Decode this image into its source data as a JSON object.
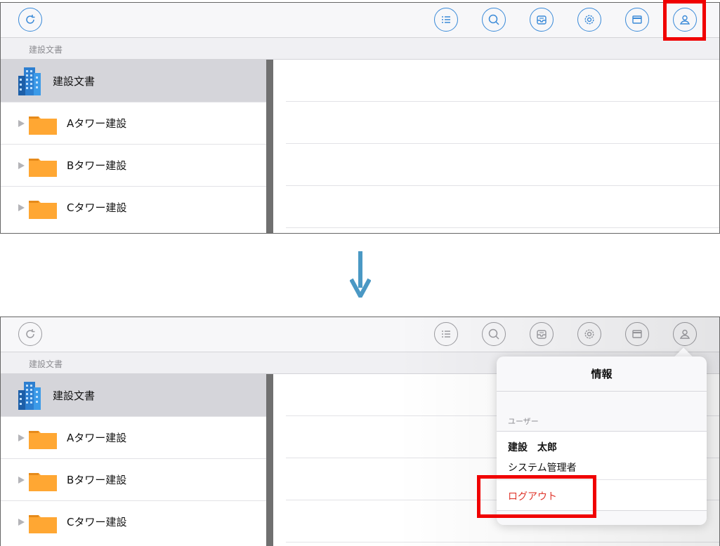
{
  "path": "建設文書",
  "tree": {
    "root": "建設文書",
    "items": [
      "Aタワー建設",
      "Bタワー建設",
      "Cタワー建設"
    ]
  },
  "toolbar_icons": [
    "refresh-icon",
    "list-icon",
    "search-icon",
    "inbox-icon",
    "gear-icon",
    "window-icon",
    "user-icon"
  ],
  "popover": {
    "title": "情報",
    "section_label": "ユーザー",
    "user_name": "建設　太郎",
    "user_role": "システム管理者",
    "logout_label": "ログアウト"
  },
  "colors": {
    "accent": "#3a8ad8",
    "highlight": "#f00000",
    "folder": "#ffa733",
    "logout": "#e0382e",
    "arrow": "#4a98c4"
  }
}
